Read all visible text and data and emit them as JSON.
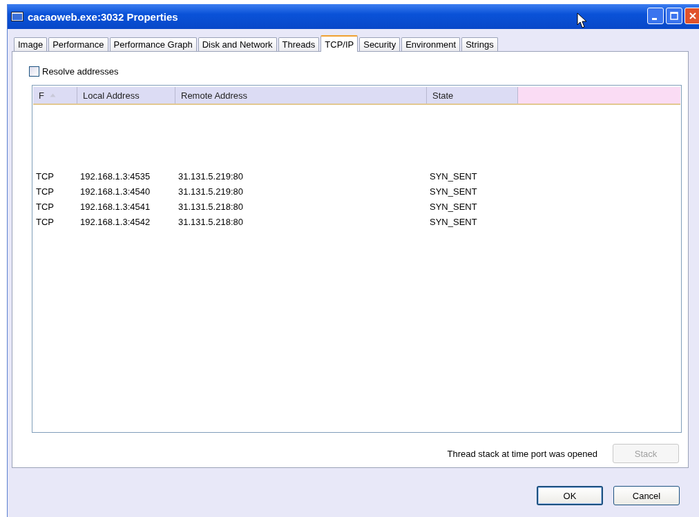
{
  "window": {
    "title": "cacaoweb.exe:3032 Properties"
  },
  "tabs": [
    {
      "label": "Image",
      "selected": false
    },
    {
      "label": "Performance",
      "selected": false
    },
    {
      "label": "Performance Graph",
      "selected": false
    },
    {
      "label": "Disk and Network",
      "selected": false
    },
    {
      "label": "Threads",
      "selected": false
    },
    {
      "label": "TCP/IP",
      "selected": true
    },
    {
      "label": "Security",
      "selected": false
    },
    {
      "label": "Environment",
      "selected": false
    },
    {
      "label": "Strings",
      "selected": false
    }
  ],
  "resolve_addresses": {
    "label": "Resolve addresses",
    "checked": false
  },
  "table": {
    "columns": [
      "F",
      "Local Address",
      "Remote Address",
      "State"
    ],
    "rows": [
      [
        "TCP",
        "192.168.1.3:4535",
        "31.131.5.219:80",
        "SYN_SENT"
      ],
      [
        "TCP",
        "192.168.1.3:4540",
        "31.131.5.219:80",
        "SYN_SENT"
      ],
      [
        "TCP",
        "192.168.1.3:4541",
        "31.131.5.218:80",
        "SYN_SENT"
      ],
      [
        "TCP",
        "192.168.1.3:4542",
        "31.131.5.218:80",
        "SYN_SENT"
      ]
    ]
  },
  "stack": {
    "label": "Thread stack at time port was opened",
    "button": "Stack",
    "disabled": true
  },
  "buttons": [
    "OK",
    "Cancel"
  ]
}
